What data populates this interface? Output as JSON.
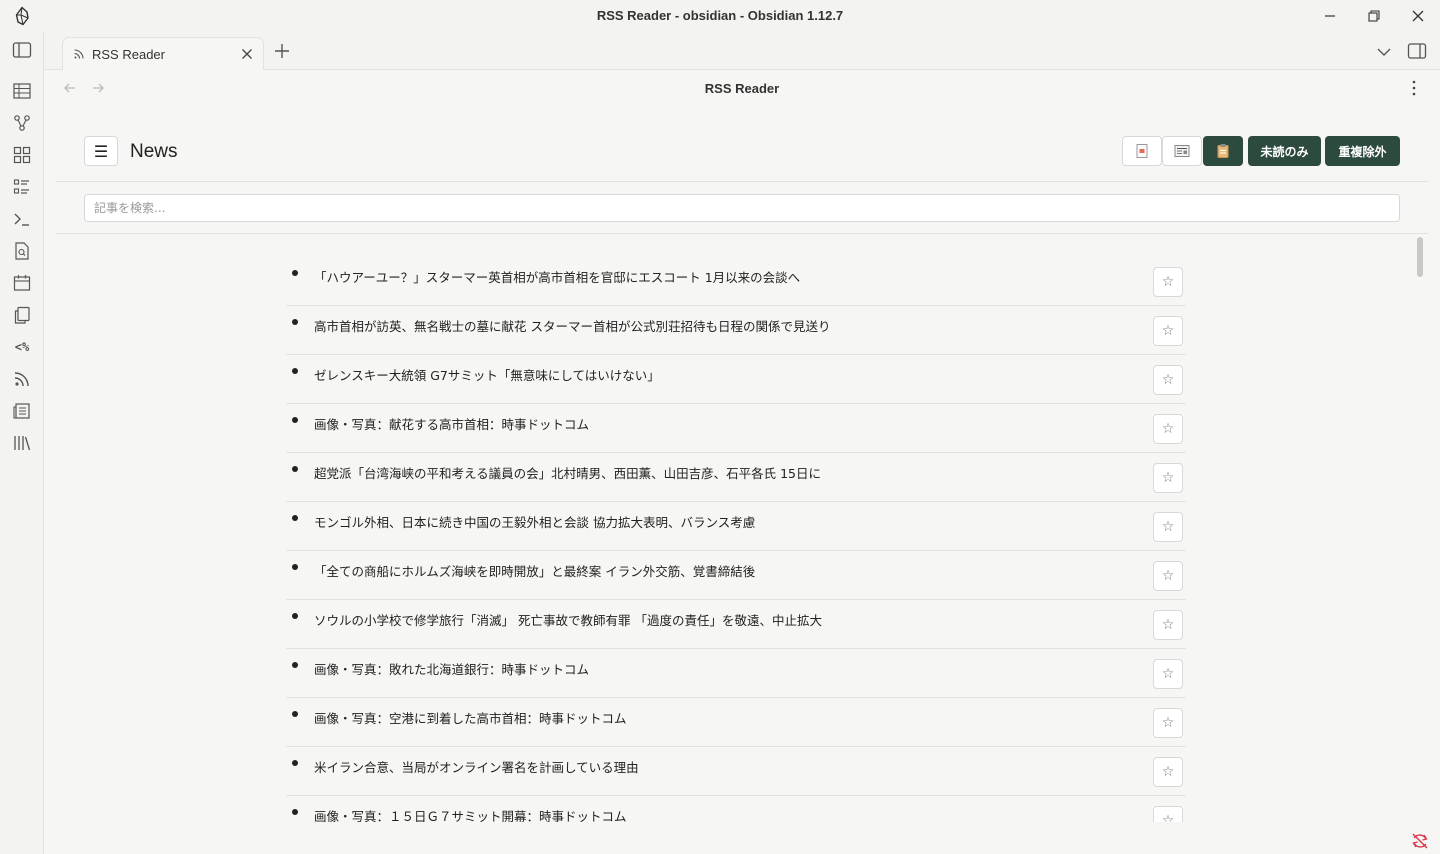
{
  "window": {
    "title": "RSS Reader - obsidian - Obsidian 1.12.7"
  },
  "ribbon": {
    "icons": [
      "table-icon",
      "graph-icon",
      "grid-icon",
      "list-icon",
      "terminal-icon",
      "file-search-icon",
      "calendar-icon",
      "copy-icon",
      "template-icon",
      "rss-icon",
      "newspaper-icon",
      "library-icon"
    ],
    "template_label": "<%"
  },
  "tab": {
    "title": "RSS Reader"
  },
  "view": {
    "title": "RSS Reader"
  },
  "reader": {
    "menu_label": "☰",
    "feed_title": "News",
    "unread_only_label": "未読のみ",
    "dedup_label": "重複除外"
  },
  "search": {
    "placeholder": "記事を検索...",
    "value": ""
  },
  "articles": [
    {
      "title": "「ハウアーユー？」スターマー英首相が高市首相を官邸にエスコート 1月以来の会談へ"
    },
    {
      "title": "高市首相が訪英、無名戦士の墓に献花 スターマー首相が公式別荘招待も日程の関係で見送り"
    },
    {
      "title": "ゼレンスキー大統領 G7サミット「無意味にしてはいけない」"
    },
    {
      "title": "画像・写真：献花する高市首相：時事ドットコム"
    },
    {
      "title": "超党派「台湾海峡の平和考える議員の会」北村晴男、西田薫、山田吉彦、石平各氏 15日に"
    },
    {
      "title": "モンゴル外相、日本に続き中国の王毅外相と会談 協力拡大表明、バランス考慮"
    },
    {
      "title": "「全ての商船にホルムズ海峡を即時開放」と最終案 イラン外交筋、覚書締結後"
    },
    {
      "title": "ソウルの小学校で修学旅行「消滅」 死亡事故で教師有罪 「過度の責任」を敬遠、中止拡大"
    },
    {
      "title": "画像・写真：敗れた北海道銀行：時事ドットコム"
    },
    {
      "title": "画像・写真：空港に到着した高市首相：時事ドットコム"
    },
    {
      "title": "米イラン合意、当局がオンライン署名を計画している理由"
    },
    {
      "title": "画像・写真：１５日Ｇ７サミット開幕：時事ドットコム"
    }
  ],
  "colors": {
    "accent": "#2d4a3e",
    "background": "#f6f6f4",
    "border": "#e2e2e0",
    "error": "#d9344a"
  }
}
